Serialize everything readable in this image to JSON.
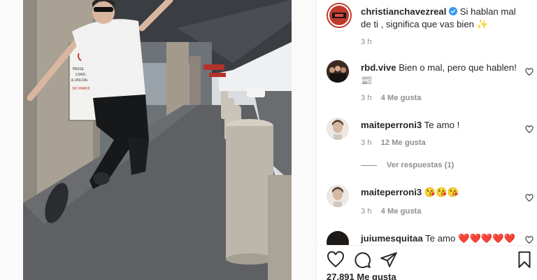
{
  "post": {
    "author": "christianchavezreal",
    "caption": "Si hablan mal de ti , significa que vas bien ✨",
    "time": "3 h"
  },
  "photo_sign": {
    "line1": "PASSENGER",
    "line2": "LOADING",
    "line3": "& UNLOADING",
    "line4": "NO PARKING"
  },
  "comments": [
    {
      "user": "rbd.vive",
      "text": "Bien o mal, pero que hablen! 📰",
      "time": "3 h",
      "likes": "4 Me gusta"
    },
    {
      "user": "maiteperroni3",
      "text": "Te amo !",
      "time": "3 h",
      "likes": "12 Me gusta"
    },
    {
      "user": "maiteperroni3",
      "text": "😘😘😘",
      "time": "3 h",
      "likes": "4 Me gusta"
    },
    {
      "user": "juiumesquitaa",
      "text": "Te amo ❤️❤️❤️❤️❤️❤️"
    }
  ],
  "replies_label": "Ver respuestas (1)",
  "likes_total": "27.891 Me gusta",
  "colors": {
    "verified": "#3897f0",
    "muted": "#8e8e8e",
    "text": "#262626"
  },
  "icons": [
    "heart-icon",
    "comment-icon",
    "share-icon",
    "bookmark-icon",
    "verified-icon"
  ]
}
